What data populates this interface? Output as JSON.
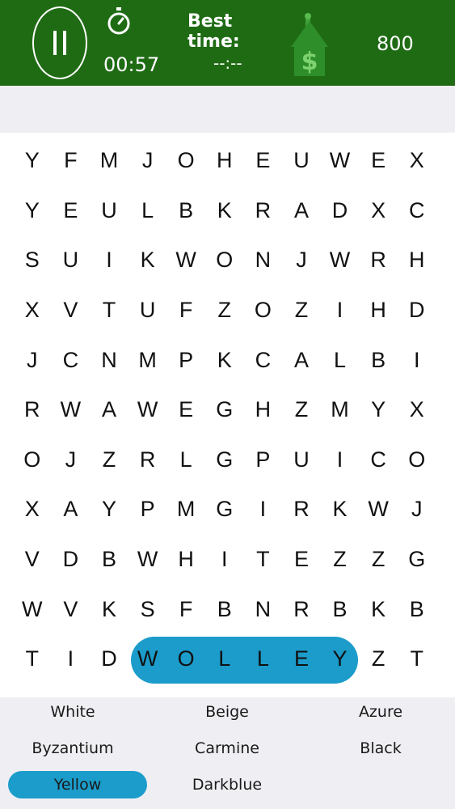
{
  "header": {
    "timer": "00:57",
    "best_time_label": "Best time:",
    "best_time_value": "--:--",
    "score": "800"
  },
  "colors": {
    "header_bg": "#1f6b14",
    "highlight": "#1b9ccb",
    "panel_bg": "#efeef2"
  },
  "icons": {
    "pause": "pause-icon",
    "stopwatch": "stopwatch-icon",
    "home": "home-dollar-icon"
  },
  "grid": {
    "rows": [
      [
        "Y",
        "F",
        "M",
        "J",
        "O",
        "H",
        "E",
        "U",
        "W",
        "E",
        "X"
      ],
      [
        "Y",
        "E",
        "U",
        "L",
        "B",
        "K",
        "R",
        "A",
        "D",
        "X",
        "C"
      ],
      [
        "S",
        "U",
        "I",
        "K",
        "W",
        "O",
        "N",
        "J",
        "W",
        "R",
        "H"
      ],
      [
        "X",
        "V",
        "T",
        "U",
        "F",
        "Z",
        "O",
        "Z",
        "I",
        "H",
        "D"
      ],
      [
        "J",
        "C",
        "N",
        "M",
        "P",
        "K",
        "C",
        "A",
        "L",
        "B",
        "I"
      ],
      [
        "R",
        "W",
        "A",
        "W",
        "E",
        "G",
        "H",
        "Z",
        "M",
        "Y",
        "X"
      ],
      [
        "O",
        "J",
        "Z",
        "R",
        "L",
        "G",
        "P",
        "U",
        "I",
        "C",
        "O"
      ],
      [
        "X",
        "A",
        "Y",
        "P",
        "M",
        "G",
        "I",
        "R",
        "K",
        "W",
        "J"
      ],
      [
        "V",
        "D",
        "B",
        "W",
        "H",
        "I",
        "T",
        "E",
        "Z",
        "Z",
        "G"
      ],
      [
        "W",
        "V",
        "K",
        "S",
        "F",
        "B",
        "N",
        "R",
        "B",
        "K",
        "B"
      ],
      [
        "T",
        "I",
        "D",
        "W",
        "O",
        "L",
        "L",
        "E",
        "Y",
        "Z",
        "T"
      ]
    ]
  },
  "words": [
    {
      "label": "White",
      "found": false
    },
    {
      "label": "Beige",
      "found": false
    },
    {
      "label": "Azure",
      "found": false
    },
    {
      "label": "Byzantium",
      "found": false
    },
    {
      "label": "Carmine",
      "found": false
    },
    {
      "label": "Black",
      "found": false
    },
    {
      "label": "Yellow",
      "found": true
    },
    {
      "label": "Darkblue",
      "found": false
    }
  ]
}
